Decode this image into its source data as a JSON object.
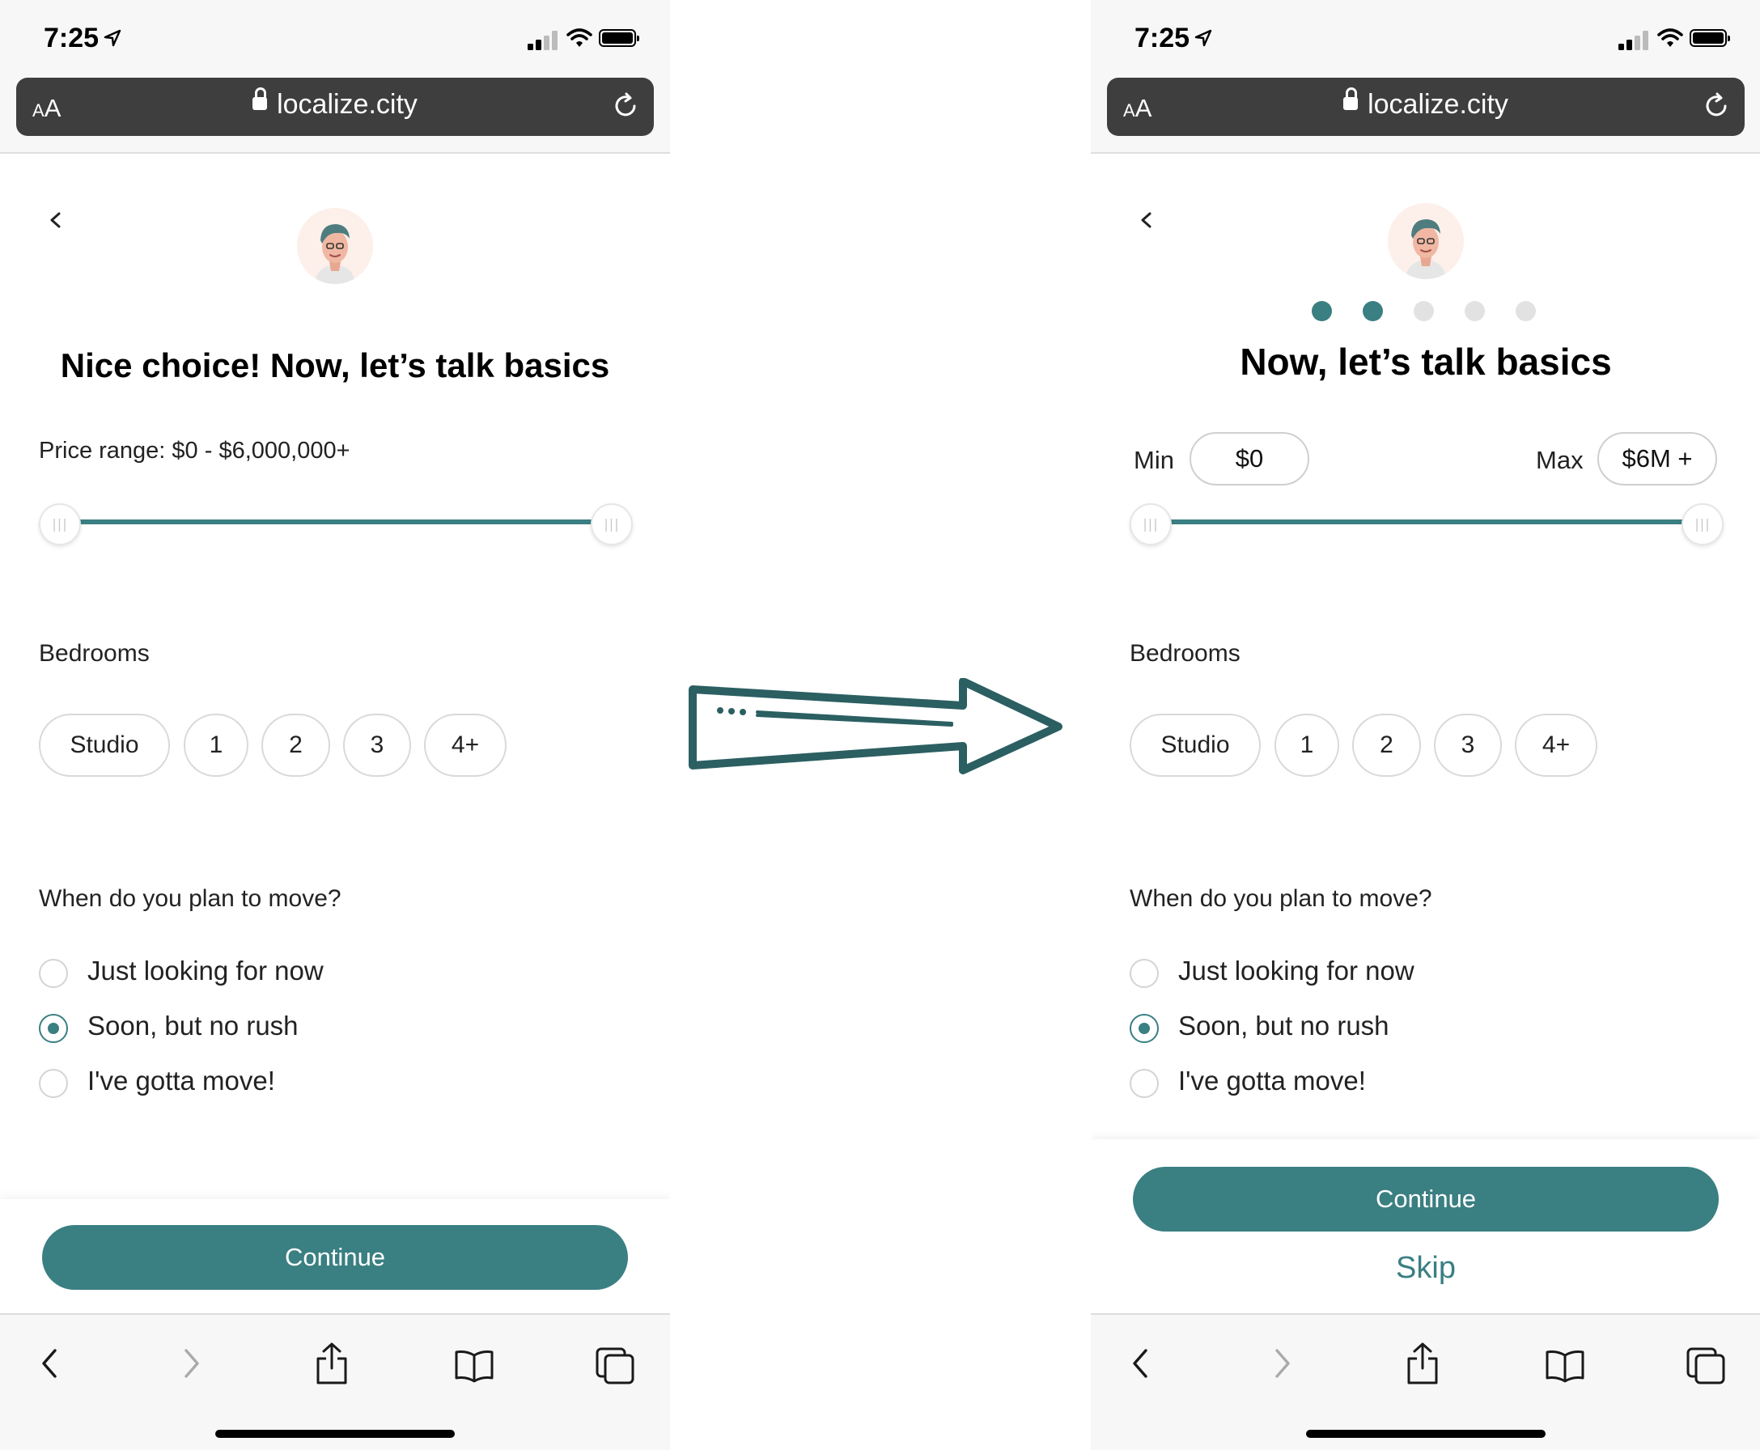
{
  "status_bar": {
    "time": "7:25"
  },
  "browser": {
    "text_size_small": "A",
    "text_size_big": "A",
    "url": "localize.city"
  },
  "left_screen": {
    "title": "Nice choice! Now, let’s talk basics",
    "price_label": "Price range: $0 - $6,000,000+",
    "bedrooms_label": "Bedrooms",
    "bedroom_options": [
      "Studio",
      "1",
      "2",
      "3",
      "4+"
    ],
    "move_question": "When do you plan to move?",
    "move_options": [
      "Just looking for now",
      "Soon, but no rush",
      "I've gotta move!"
    ],
    "selected_move_option": "Soon, but no rush",
    "continue_label": "Continue"
  },
  "right_screen": {
    "progress": {
      "steps": 5,
      "completed": 2
    },
    "title": "Now, let’s talk basics",
    "min_label": "Min",
    "min_value": "$0",
    "max_label": "Max",
    "max_value": "$6M +",
    "bedrooms_label": "Bedrooms",
    "bedroom_options": [
      "Studio",
      "1",
      "2",
      "3",
      "4+"
    ],
    "move_question": "When do you plan to move?",
    "move_options": [
      "Just looking for now",
      "Soon, but no rush",
      "I've gotta move!"
    ],
    "selected_move_option": "Soon, but no rush",
    "continue_label": "Continue",
    "skip_label": "Skip"
  },
  "slider": {
    "min_fraction": 0,
    "max_fraction": 1,
    "handle_grip": "|||"
  },
  "colors": {
    "accent": "#3a7f82",
    "address_bar": "#3e3e3e",
    "arrow": "#2b5f62"
  },
  "icons": [
    "location-arrow-icon",
    "signal-icon",
    "wifi-icon",
    "battery-icon",
    "lock-icon",
    "reload-icon",
    "chevron-left-icon",
    "avatar-icon",
    "back-icon",
    "forward-icon",
    "share-icon",
    "bookmarks-icon",
    "tabs-icon",
    "transition-arrow-icon"
  ]
}
